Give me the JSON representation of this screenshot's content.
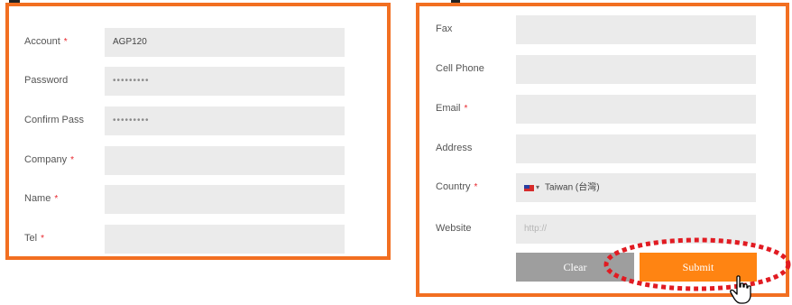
{
  "left_form": {
    "fields": [
      {
        "label": "Account",
        "required": "*",
        "value": "AGP120"
      },
      {
        "label": "Password",
        "required": "",
        "value": "•••••••••"
      },
      {
        "label": "Confirm Pass",
        "required": "",
        "value": "•••••••••"
      },
      {
        "label": "Company",
        "required": "*",
        "value": ""
      },
      {
        "label": "Name",
        "required": "*",
        "value": ""
      },
      {
        "label": "Tel",
        "required": "*",
        "value": ""
      }
    ]
  },
  "right_form": {
    "fields": [
      {
        "label": "Fax",
        "required": "",
        "value": ""
      },
      {
        "label": "Cell Phone",
        "required": "",
        "value": ""
      },
      {
        "label": "Email",
        "required": "*",
        "value": ""
      },
      {
        "label": "Address",
        "required": "",
        "value": ""
      },
      {
        "label": "Country",
        "required": "*",
        "value": "Taiwan (台灣)"
      },
      {
        "label": "Website",
        "required": "",
        "placeholder": "http://"
      }
    ],
    "buttons": {
      "clear": "Clear",
      "submit": "Submit"
    }
  },
  "colors": {
    "panel_border": "#f26f21",
    "submit": "#ff8412",
    "clear": "#9e9e9e",
    "input_bg": "#ebebeb",
    "required": "#e8262d",
    "highlight_ellipse": "#e11b22"
  },
  "icons": {
    "country_flag": "taiwan-flag-icon",
    "dropdown": "chevron-down-icon",
    "cursor": "hand-pointer-icon"
  }
}
